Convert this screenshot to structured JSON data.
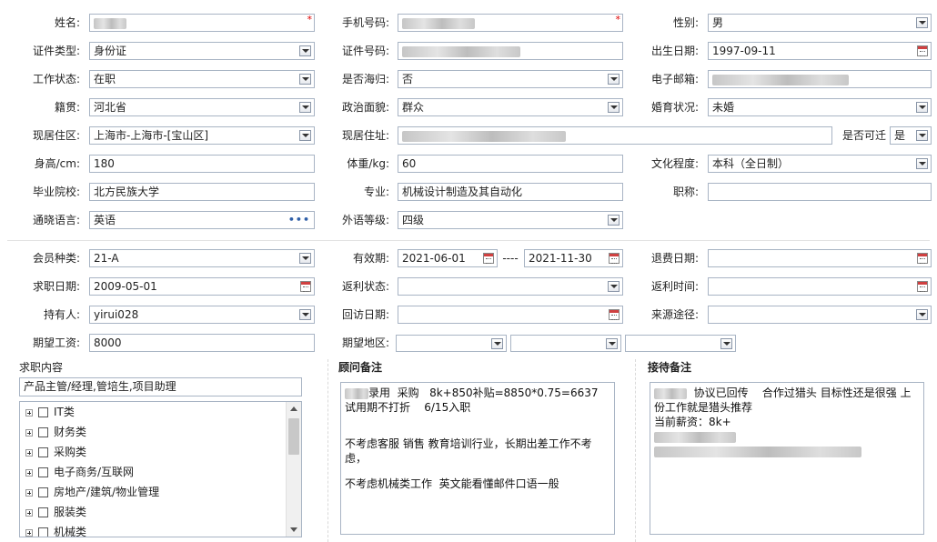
{
  "labels": {
    "name": "姓名:",
    "phone": "手机号码:",
    "gender": "性别:",
    "id_type": "证件类型:",
    "id_no": "证件号码:",
    "birth": "出生日期:",
    "work_status": "工作状态:",
    "returnee": "是否海归:",
    "email": "电子邮箱:",
    "native": "籍贯:",
    "politics": "政治面貌:",
    "marital": "婚育状况:",
    "residence_area": "现居住区:",
    "address": "现居住址:",
    "relocate": "是否可迁",
    "height": "身高/cm:",
    "weight": "体重/kg:",
    "education": "文化程度:",
    "school": "毕业院校:",
    "major": "专业:",
    "title": "职称:",
    "language": "通晓语言:",
    "lang_level": "外语等级:",
    "member_type": "会员种类:",
    "valid": "有效期:",
    "valid_sep": "----",
    "refund_date": "退费日期:",
    "job_date": "求职日期:",
    "rebate_status": "返利状态:",
    "rebate_time": "返利时间:",
    "holder": "持有人:",
    "visit_date": "回访日期:",
    "source": "来源途径:",
    "salary": "期望工资:",
    "region": "期望地区:"
  },
  "values": {
    "gender": "男",
    "id_type": "身份证",
    "birth": "1997-09-11",
    "work_status": "在职",
    "returnee": "否",
    "native": "河北省",
    "politics": "群众",
    "marital": "未婚",
    "residence_area": "上海市-上海市-[宝山区]",
    "relocate": "是",
    "height": "180",
    "weight": "60",
    "education": "本科（全日制）",
    "school": "北方民族大学",
    "major": "机械设计制造及其自动化",
    "title": "",
    "language": "英语",
    "lang_level": "四级",
    "member_type": "21-A",
    "valid_from": "2021-06-01",
    "valid_to": "2021-11-30",
    "refund_date": "",
    "job_date": "2009-05-01",
    "rebate_status": "",
    "rebate_time": "",
    "holder": "yirui028",
    "visit_date": "",
    "source": "",
    "salary": "8000",
    "region1": "",
    "region2": "",
    "region3": ""
  },
  "job_section": {
    "title": "求职内容",
    "summary": "产品主管/经理,管培生,项目助理",
    "tree": [
      "IT类",
      "财务类",
      "采购类",
      "电子商务/互联网",
      "房地产/建筑/物业管理",
      "服装类",
      "机械类"
    ]
  },
  "advisor_notes": {
    "title": "顾问备注",
    "line1": "录用  采购   8k+850补贴=8850*0.75=6637  试用期不打折    6/15入职",
    "line2": "不考虑客服 销售 教育培训行业，长期出差工作不考虑，",
    "line3": "不考虑机械类工作  英文能看懂邮件口语一般"
  },
  "reception_notes": {
    "title": "接待备注",
    "line1": "协议已回传    合作过猎头 目标性还是很强 上份工作就是猎头推荐",
    "line2": "当前薪资：8k+"
  },
  "colors": {
    "border": "#a8b4c4",
    "required": "#dd0000",
    "ellipsis": "#2f5fa8"
  }
}
